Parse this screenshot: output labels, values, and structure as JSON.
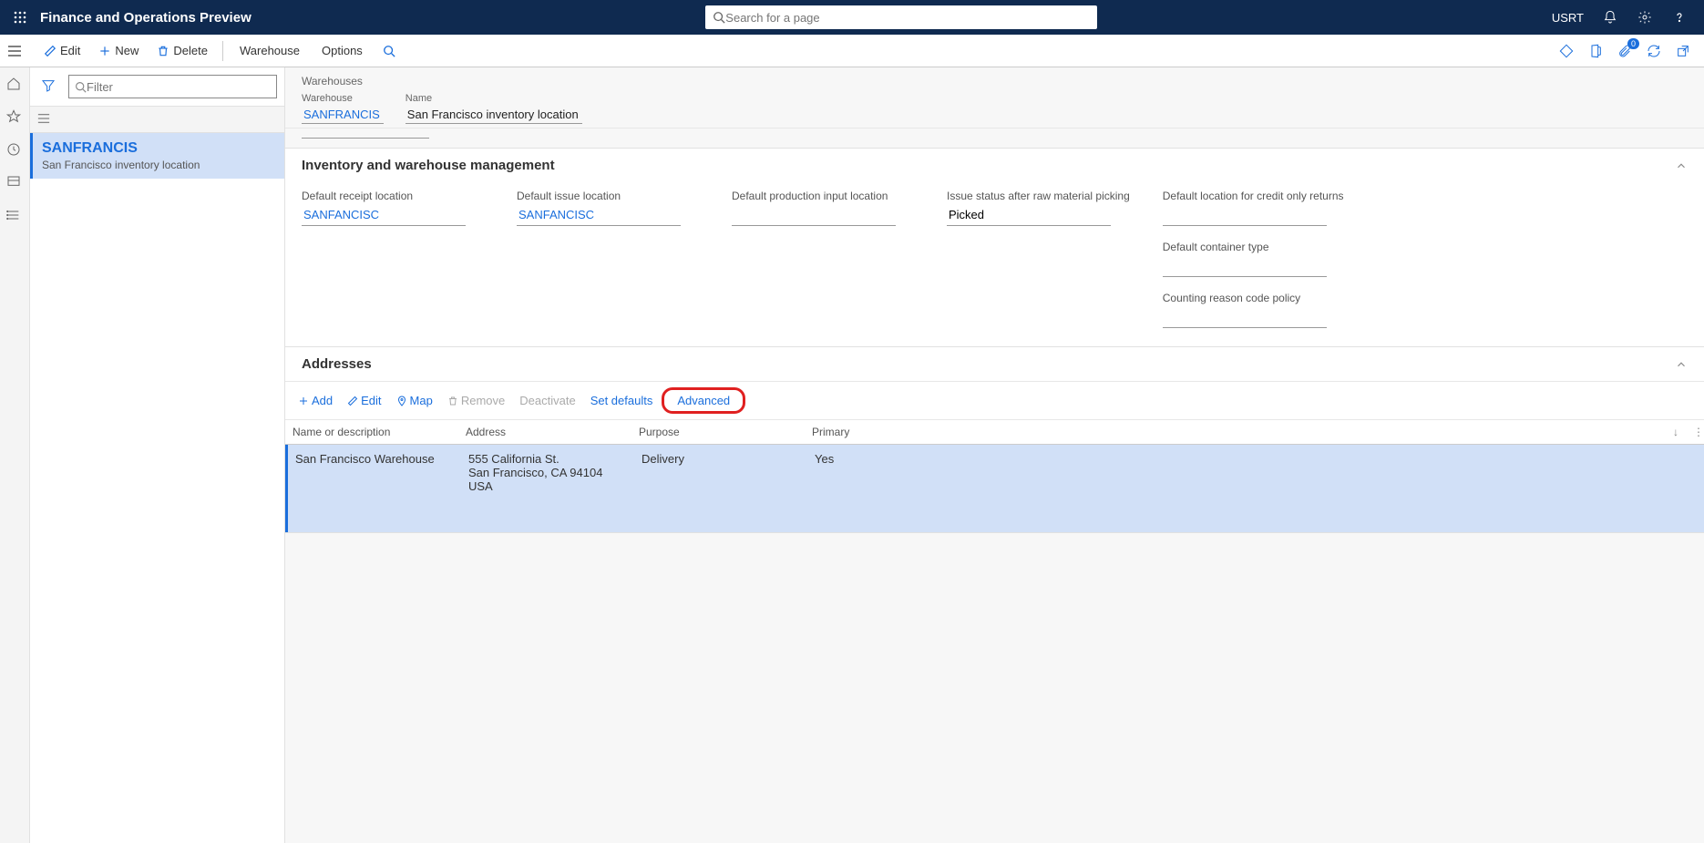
{
  "topnav": {
    "app_title": "Finance and Operations Preview",
    "search_placeholder": "Search for a page",
    "user_label": "USRT"
  },
  "actions": {
    "edit": "Edit",
    "new": "New",
    "delete": "Delete",
    "warehouse": "Warehouse",
    "options": "Options",
    "notif_count": "0"
  },
  "listpane": {
    "filter_placeholder": "Filter",
    "items": [
      {
        "code": "SANFRANCIS",
        "name": "San Francisco inventory location"
      }
    ]
  },
  "breadcrumb": "Warehouses",
  "header_fields": {
    "warehouse_label": "Warehouse",
    "warehouse_value": "SANFRANCIS",
    "name_label": "Name",
    "name_value": "San Francisco inventory location"
  },
  "section_inventory": {
    "title": "Inventory and warehouse management",
    "fields": {
      "default_receipt_label": "Default receipt location",
      "default_receipt_value": "SANFANCISC",
      "default_issue_label": "Default issue location",
      "default_issue_value": "SANFANCISC",
      "default_prod_label": "Default production input location",
      "default_prod_value": "",
      "issue_status_label": "Issue status after raw material picking",
      "issue_status_value": "Picked",
      "default_credit_label": "Default location for credit only returns",
      "default_credit_value": "",
      "default_container_label": "Default container type",
      "default_container_value": "",
      "counting_reason_label": "Counting reason code policy",
      "counting_reason_value": ""
    }
  },
  "addresses": {
    "title": "Addresses",
    "toolbar": {
      "add": "Add",
      "edit": "Edit",
      "map": "Map",
      "remove": "Remove",
      "deactivate": "Deactivate",
      "set_defaults": "Set defaults",
      "advanced": "Advanced"
    },
    "columns": {
      "name": "Name or description",
      "address": "Address",
      "purpose": "Purpose",
      "primary": "Primary"
    },
    "rows": [
      {
        "name": "San Francisco Warehouse",
        "address": "555 California St.\nSan Francisco, CA 94104\nUSA",
        "purpose": "Delivery",
        "primary": "Yes"
      }
    ]
  }
}
